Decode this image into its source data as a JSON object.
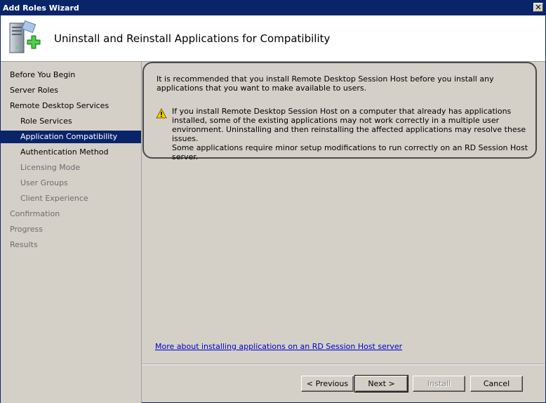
{
  "window": {
    "title": "Add Roles Wizard",
    "close_glyph": "✕"
  },
  "header": {
    "title": "Uninstall and Reinstall Applications for Compatibility",
    "icon": "server-add-icon"
  },
  "sidebar": {
    "steps": [
      {
        "label": "Before You Begin"
      },
      {
        "label": "Server Roles"
      },
      {
        "label": "Remote Desktop Services"
      },
      {
        "label": "Role Services"
      },
      {
        "label": "Application Compatibility"
      },
      {
        "label": "Authentication Method"
      },
      {
        "label": "Licensing Mode"
      },
      {
        "label": "User Groups"
      },
      {
        "label": "Client Experience"
      },
      {
        "label": "Confirmation"
      },
      {
        "label": "Progress"
      },
      {
        "label": "Results"
      }
    ]
  },
  "main": {
    "intro": "It is recommended that you install Remote Desktop Session Host before you install any applications that you want to make available to users.",
    "warning": "If you install Remote Desktop Session Host on a computer that already has applications installed, some of the existing applications may not work correctly in a multiple user environment. Uninstalling and then reinstalling the affected applications may resolve these issues.",
    "note": "Some applications require minor setup modifications to run correctly on an RD Session Host server.",
    "warning_icon": "warning-icon",
    "help_link": "More about installing applications on an RD Session Host server"
  },
  "buttons": {
    "previous": "< Previous",
    "next": "Next >",
    "install": "Install",
    "cancel": "Cancel"
  },
  "colors": {
    "titlebar": "#0a246a",
    "selection": "#0a246a",
    "link": "#0000cc"
  }
}
